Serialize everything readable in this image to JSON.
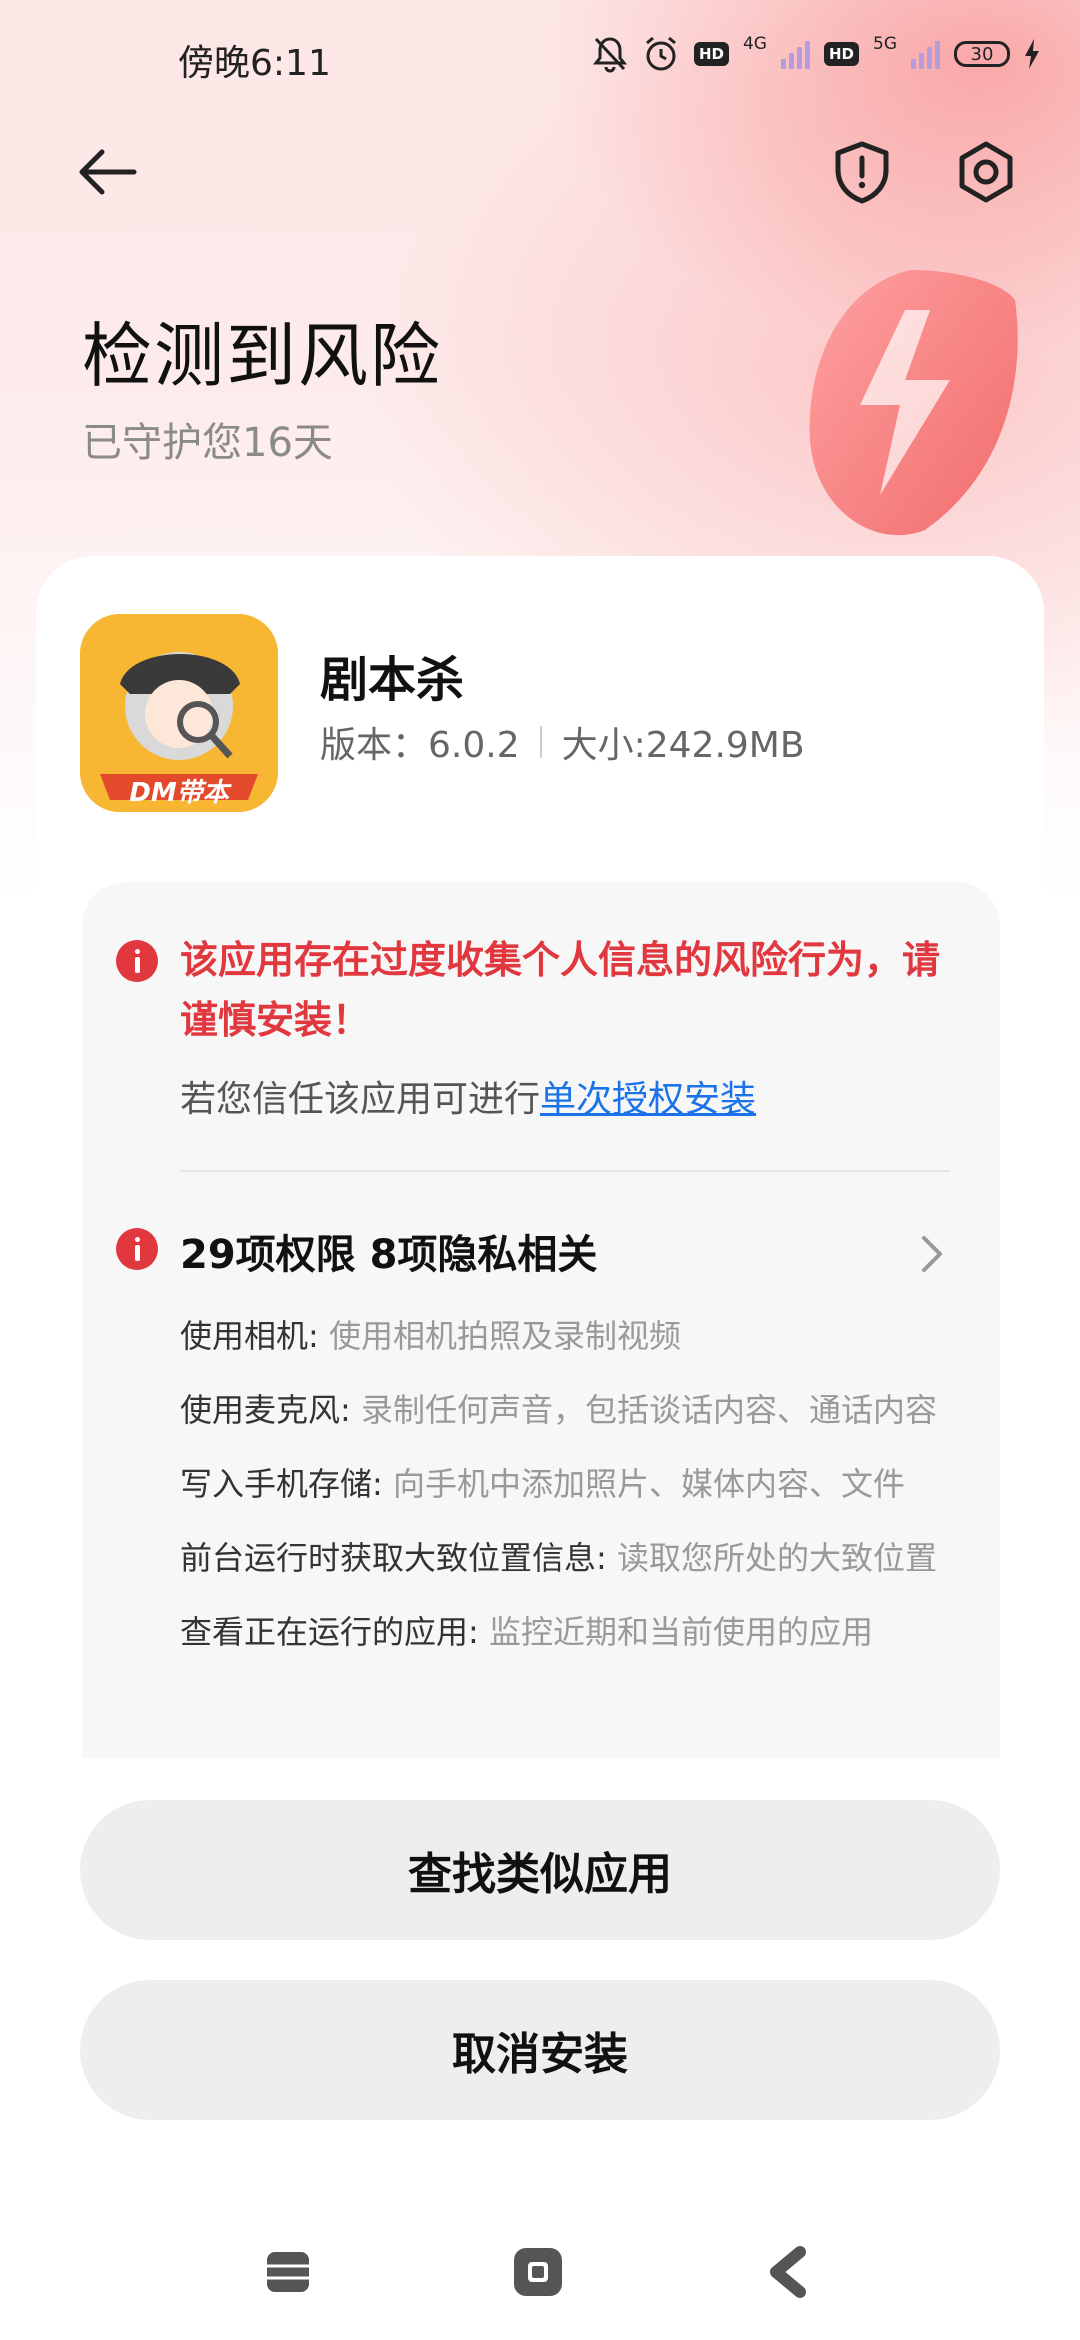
{
  "status_bar": {
    "time": "傍晚6:11",
    "net1": "4G",
    "hd1": "HD",
    "net2": "5G",
    "hd2": "HD",
    "battery": "30"
  },
  "header": {
    "title": "检测到风险",
    "subtitle": "已守护您16天"
  },
  "app": {
    "name": "剧本杀",
    "version": "版本：6.0.2",
    "size": "大小:242.9MB",
    "icon_badge": "DM带本"
  },
  "risk": {
    "warning": "该应用存在过度收集个人信息的风险行为，请谨慎安装！",
    "trust_prefix": "若您信任该应用可进行",
    "trust_link": "单次授权安装",
    "permissions_title": "29项权限 8项隐私相关",
    "permissions": [
      {
        "name": "使用相机:",
        "desc": " 使用相机拍照及录制视频"
      },
      {
        "name": "使用麦克风:",
        "desc": " 录制任何声音，包括谈话内容、通话内容"
      },
      {
        "name": "写入手机存储:",
        "desc": " 向手机中添加照片、媒体内容、文件"
      },
      {
        "name": "前台运行时获取大致位置信息:",
        "desc": " 读取您所处的大致位置"
      },
      {
        "name": "查看正在运行的应用:",
        "desc": " 监控近期和当前使用的应用"
      }
    ]
  },
  "buttons": {
    "find_similar": "查找类似应用",
    "cancel_install": "取消安装"
  },
  "colors": {
    "risk_red": "#e0383e",
    "link_blue": "#1a73e8",
    "button_bg": "#eeeeee"
  },
  "icons": [
    "back-arrow-icon",
    "shield-alert-icon",
    "settings-icon",
    "mute-icon",
    "alarm-icon",
    "battery-icon",
    "menu-icon",
    "home-icon",
    "back-nav-icon"
  ]
}
